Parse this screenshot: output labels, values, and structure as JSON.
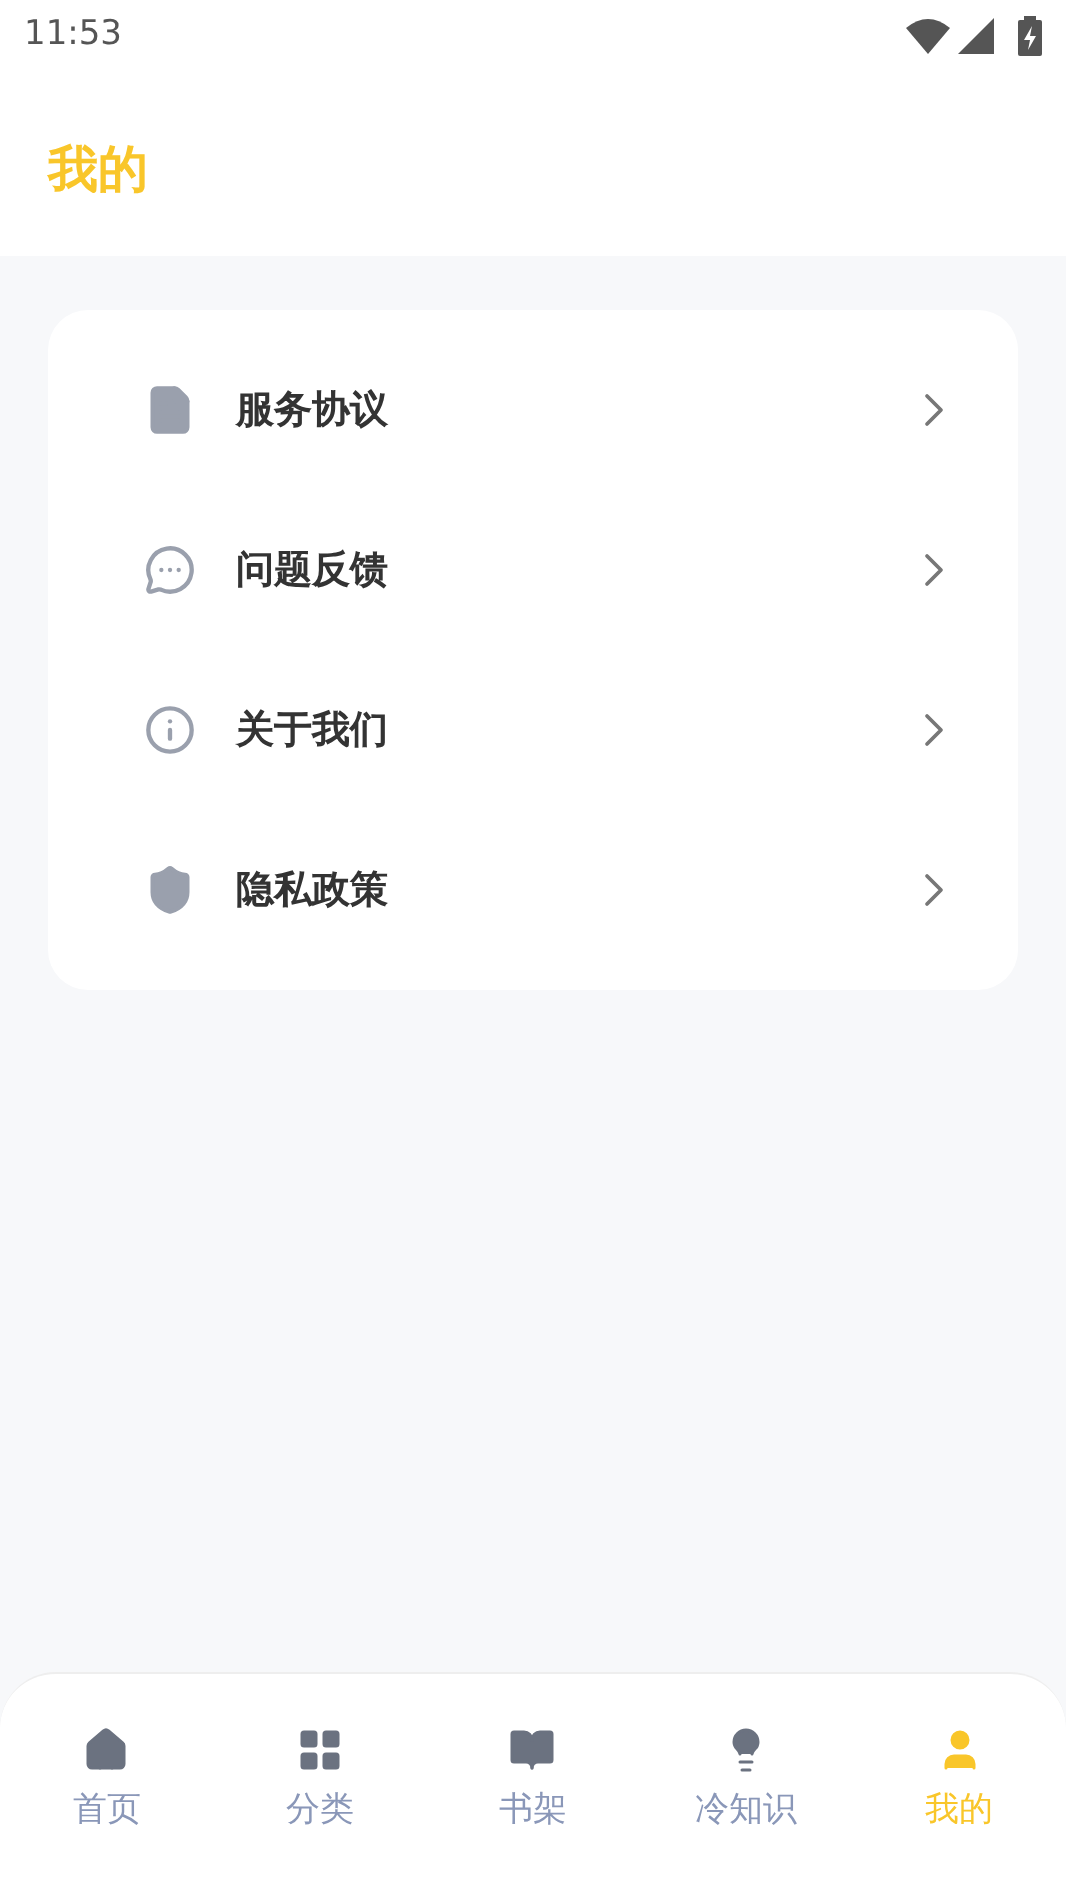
{
  "status_bar": {
    "time": "11:53"
  },
  "header": {
    "title": "我的"
  },
  "menu": [
    {
      "label": "服务协议"
    },
    {
      "label": "问题反馈"
    },
    {
      "label": "关于我们"
    },
    {
      "label": "隐私政策"
    }
  ],
  "tab_bar": [
    {
      "label": "首页",
      "selected": false
    },
    {
      "label": "分类",
      "selected": false
    },
    {
      "label": "书架",
      "selected": false
    },
    {
      "label": "冷知识",
      "selected": false
    },
    {
      "label": "我的",
      "selected": true
    }
  ]
}
